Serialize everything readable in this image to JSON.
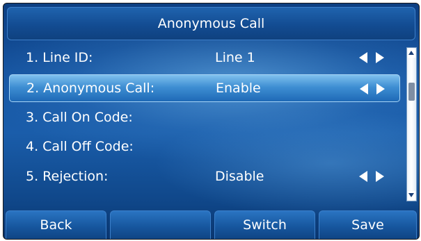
{
  "title": "Anonymous Call",
  "rows": [
    {
      "label": "1. Line ID:",
      "value": "Line 1",
      "arrows": true,
      "selected": false
    },
    {
      "label": "2. Anonymous Call:",
      "value": "Enable",
      "arrows": true,
      "selected": true
    },
    {
      "label": "3. Call On Code:",
      "value": "",
      "arrows": false,
      "selected": false
    },
    {
      "label": "4. Call Off Code:",
      "value": "",
      "arrows": false,
      "selected": false
    },
    {
      "label": "5. Rejection:",
      "value": "Disable",
      "arrows": true,
      "selected": false
    }
  ],
  "softkeys": {
    "back": "Back",
    "blank": "",
    "switch": "Switch",
    "save": "Save"
  },
  "colors": {
    "background": "#1656a4",
    "selected_row": "#3f8fd3",
    "text": "#ffffff"
  },
  "icons": [
    "left-arrow-icon",
    "right-arrow-icon",
    "scroll-up-icon",
    "scroll-down-icon"
  ]
}
